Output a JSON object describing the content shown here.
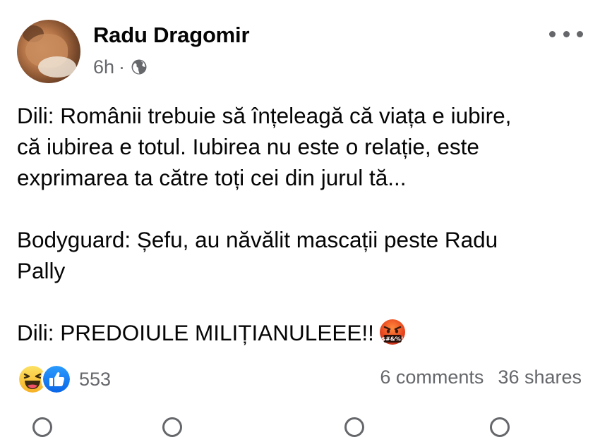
{
  "post": {
    "author": {
      "name": "Radu Dragomir"
    },
    "meta": {
      "time": "6h",
      "separator": "·",
      "privacy_icon": "globe-icon"
    },
    "more_icon": "more-horizontal-icon",
    "body": {
      "line1": "Dili: Românii trebuie să înțeleagă că viața e iubire,",
      "line2": "că iubirea e totul. Iubirea nu este o relație, este",
      "line3": "exprimarea ta către toți cei din jurul tă...",
      "line4": "Bodyguard: Șefu, au năvălit mascații peste Radu",
      "line5": "Pally",
      "line6": "Dili: PREDOIULE MILIȚIANULEEE!!",
      "emoji": "face-with-symbols-on-mouth-icon"
    },
    "stats": {
      "reaction_icons": [
        "haha-reaction-icon",
        "like-reaction-icon"
      ],
      "reaction_count": "553",
      "comments": "6 comments",
      "shares": "36 shares"
    }
  }
}
